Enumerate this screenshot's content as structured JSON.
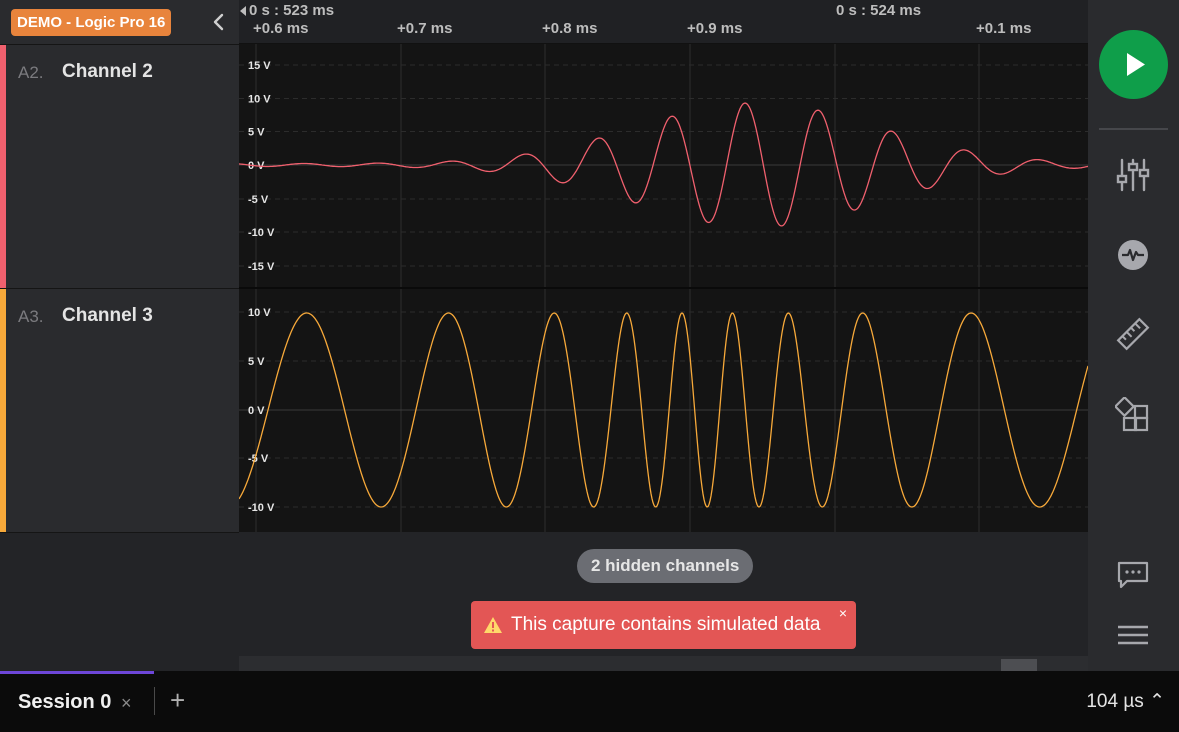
{
  "device": {
    "badge": "DEMO - Logic Pro 16"
  },
  "timeline": {
    "top_labels": [
      "0 s : 523 ms",
      "0 s : 524 ms"
    ],
    "tick_labels": [
      "+0.6 ms",
      "+0.7 ms",
      "+0.8 ms",
      "+0.9 ms",
      "+0.1 ms"
    ]
  },
  "channels": [
    {
      "index": "A2.",
      "name": "Channel 2",
      "color": "#f0606e",
      "y_labels": [
        "15 V",
        "10 V",
        "5 V",
        "0 V",
        "-5 V",
        "-10 V",
        "-15 V"
      ]
    },
    {
      "index": "A3.",
      "name": "Channel 3",
      "color": "#f7a93a",
      "y_labels": [
        "10 V",
        "5 V",
        "0 V",
        "-5 V",
        "-10 V"
      ]
    }
  ],
  "hidden_channels": "2 hidden channels",
  "toast": {
    "message": "This capture contains simulated data",
    "close": "×"
  },
  "toolbar": {
    "icons": [
      "play-icon",
      "sliders-icon",
      "analyzer-icon",
      "ruler-icon",
      "extensions-icon",
      "chat-icon",
      "menu-icon"
    ]
  },
  "session": {
    "tab_label": "Session 0",
    "close": "×",
    "add": "+"
  },
  "zoom": {
    "label": "104 µs ⌃"
  },
  "colors": {
    "accent_green": "#0f9e4a",
    "toast_red": "#e35655",
    "badge_orange": "#e8843c",
    "session_underline": "#6d46d9"
  }
}
